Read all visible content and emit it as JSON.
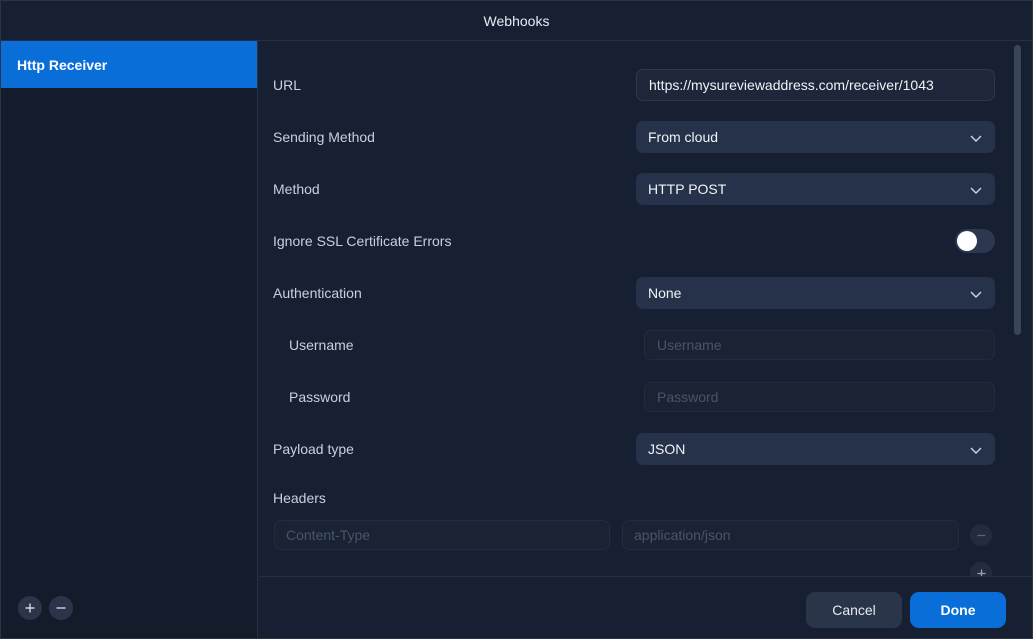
{
  "window": {
    "title": "Webhooks"
  },
  "sidebar": {
    "items": [
      {
        "label": "Http Receiver",
        "active": true
      }
    ],
    "add_icon": "plus-icon",
    "remove_icon": "minus-icon"
  },
  "form": {
    "url": {
      "label": "URL",
      "value": "https://mysureviewaddress.com/receiver/1043"
    },
    "sending_method": {
      "label": "Sending Method",
      "value": "From cloud"
    },
    "method": {
      "label": "Method",
      "value": "HTTP POST"
    },
    "ignore_ssl": {
      "label": "Ignore SSL Certificate Errors",
      "enabled": false
    },
    "authentication": {
      "label": "Authentication",
      "value": "None"
    },
    "username": {
      "label": "Username",
      "placeholder": "Username"
    },
    "password": {
      "label": "Password",
      "placeholder": "Password"
    },
    "payload_type": {
      "label": "Payload type",
      "value": "JSON"
    },
    "headers": {
      "label": "Headers",
      "rows": [
        {
          "key_placeholder": "Content-Type",
          "value_placeholder": "application/json"
        }
      ]
    }
  },
  "footer": {
    "cancel_label": "Cancel",
    "done_label": "Done"
  },
  "colors": {
    "accent": "#0a6ed9",
    "background": "#172032",
    "field": "#26324a"
  }
}
